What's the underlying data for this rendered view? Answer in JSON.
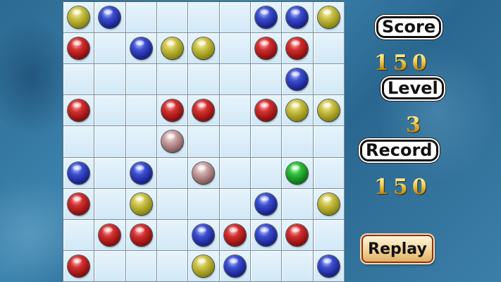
{
  "board": {
    "rows": [
      [
        "yellow",
        "blue",
        "",
        "",
        "",
        "",
        "blue",
        "blue",
        "yellow"
      ],
      [
        "red",
        "",
        "blue",
        "yellow",
        "yellow",
        "",
        "red",
        "red",
        ""
      ],
      [
        "",
        "",
        "",
        "",
        "",
        "",
        "",
        "blue",
        ""
      ],
      [
        "red",
        "",
        "",
        "red",
        "red",
        "",
        "red",
        "yellow",
        "yellow"
      ],
      [
        "",
        "",
        "",
        "pink",
        "",
        "",
        "",
        "",
        ""
      ],
      [
        "blue",
        "",
        "blue",
        "",
        "pink",
        "",
        "",
        "green",
        ""
      ],
      [
        "red",
        "",
        "yellow",
        "",
        "",
        "",
        "blue",
        "",
        "yellow"
      ],
      [
        "",
        "red",
        "red",
        "",
        "blue",
        "red",
        "blue",
        "red",
        ""
      ],
      [
        "red",
        "",
        "",
        "",
        "yellow",
        "blue",
        "",
        "",
        "blue"
      ]
    ]
  },
  "panel": {
    "score_label": "Score",
    "score_value": "150",
    "level_label": "Level",
    "level_value": "3",
    "record_label": "Record",
    "record_value": "150",
    "replay_label": "Replay"
  },
  "colors": {
    "background": "#2f72a0",
    "board": "#d8edf9",
    "grid_line": "#7b8e99",
    "number_gold": "#e3b53a",
    "replay_border": "#9a2a1f"
  }
}
